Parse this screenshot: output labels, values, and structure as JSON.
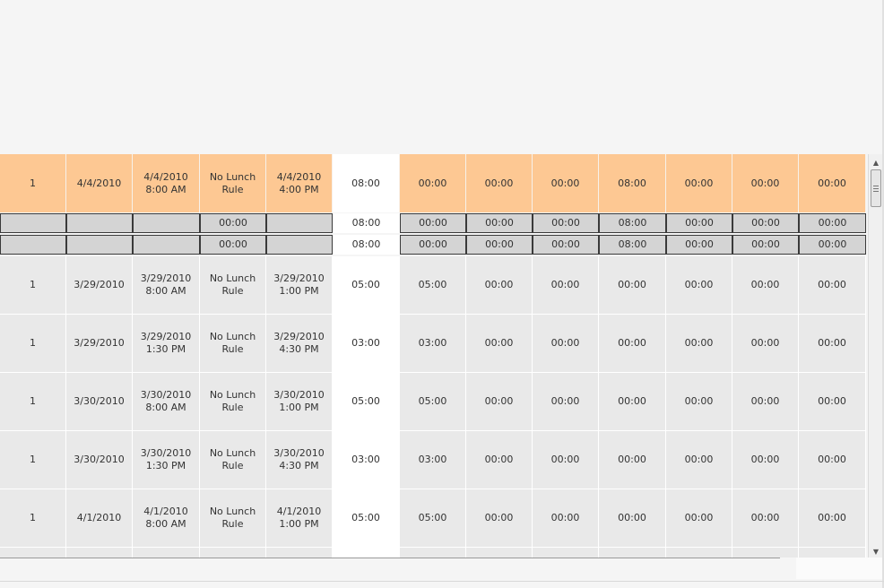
{
  "grid": {
    "selected_row": [
      "1",
      "4/4/2010",
      "4/4/2010\n8:00 AM",
      "No Lunch\nRule",
      "4/4/2010\n4:00 PM",
      "08:00",
      "00:00",
      "00:00",
      "00:00",
      "08:00",
      "00:00",
      "00:00",
      "00:00"
    ],
    "total_rows": [
      [
        "",
        "",
        "",
        "00:00",
        "",
        "08:00",
        "00:00",
        "00:00",
        "00:00",
        "08:00",
        "00:00",
        "00:00",
        "00:00"
      ],
      [
        "",
        "",
        "",
        "00:00",
        "",
        "08:00",
        "00:00",
        "00:00",
        "00:00",
        "08:00",
        "00:00",
        "00:00",
        "00:00"
      ]
    ],
    "data_rows": [
      [
        "1",
        "3/29/2010",
        "3/29/2010\n8:00 AM",
        "No Lunch\nRule",
        "3/29/2010\n1:00 PM",
        "05:00",
        "05:00",
        "00:00",
        "00:00",
        "00:00",
        "00:00",
        "00:00",
        "00:00"
      ],
      [
        "1",
        "3/29/2010",
        "3/29/2010\n1:30 PM",
        "No Lunch\nRule",
        "3/29/2010\n4:30 PM",
        "03:00",
        "03:00",
        "00:00",
        "00:00",
        "00:00",
        "00:00",
        "00:00",
        "00:00"
      ],
      [
        "1",
        "3/30/2010",
        "3/30/2010\n8:00 AM",
        "No Lunch\nRule",
        "3/30/2010\n1:00 PM",
        "05:00",
        "05:00",
        "00:00",
        "00:00",
        "00:00",
        "00:00",
        "00:00",
        "00:00"
      ],
      [
        "1",
        "3/30/2010",
        "3/30/2010\n1:30 PM",
        "No Lunch\nRule",
        "3/30/2010\n4:30 PM",
        "03:00",
        "03:00",
        "00:00",
        "00:00",
        "00:00",
        "00:00",
        "00:00",
        "00:00"
      ],
      [
        "1",
        "4/1/2010",
        "4/1/2010\n8:00 AM",
        "No Lunch\nRule",
        "4/1/2010\n1:00 PM",
        "05:00",
        "05:00",
        "00:00",
        "00:00",
        "00:00",
        "00:00",
        "00:00",
        "00:00"
      ]
    ]
  },
  "scrollbar": {
    "up_icon": "scroll-up-arrow-icon",
    "down_icon": "scroll-down-arrow-icon",
    "grip_icon": "scroll-grip-icon"
  },
  "colors": {
    "selected_row": "#fdc893",
    "total_row": "#d4d4d4",
    "data_row": "#e9e9e9",
    "highlight_column": "#ffffff"
  }
}
